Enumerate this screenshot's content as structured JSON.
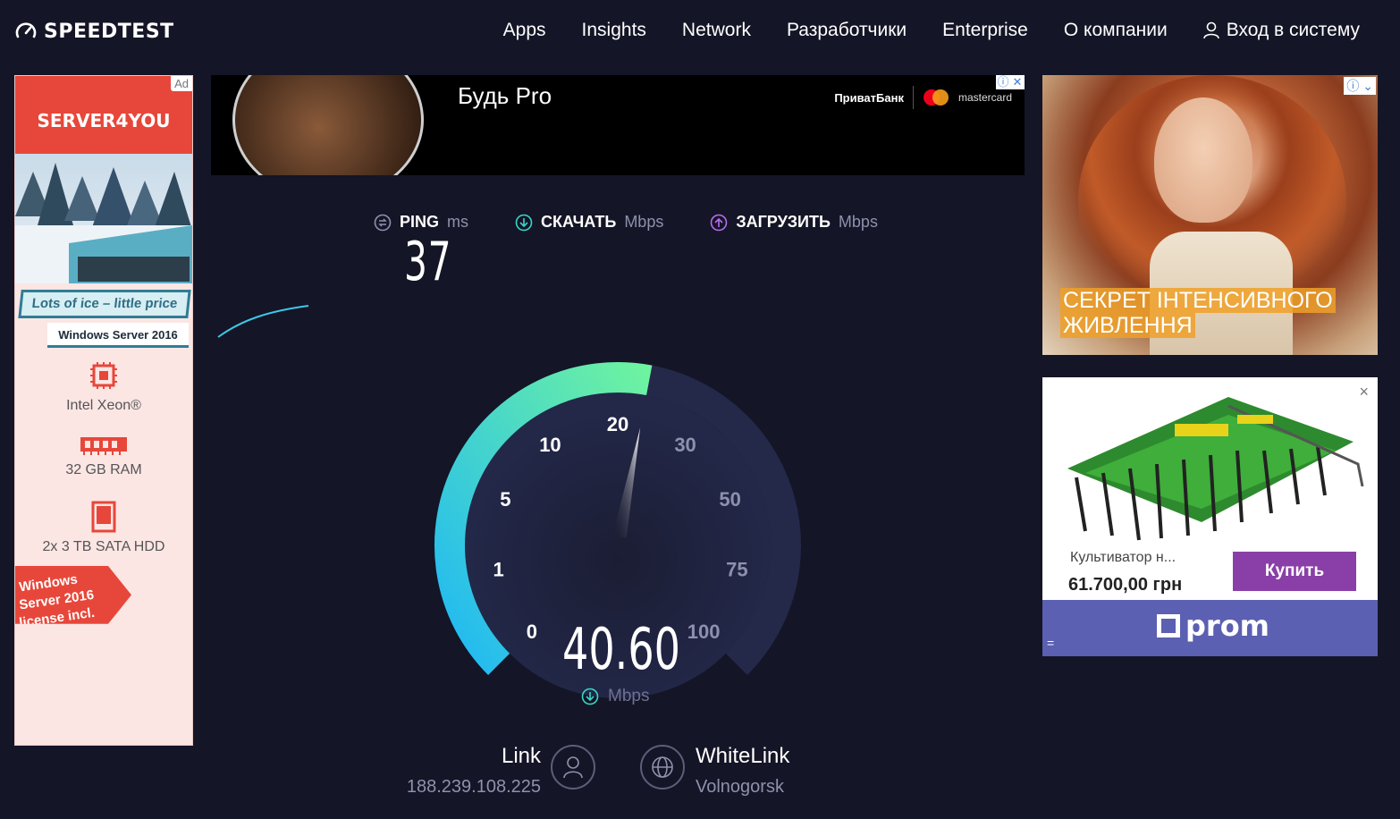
{
  "header": {
    "logo": "SPEEDTEST",
    "nav": [
      "Apps",
      "Insights",
      "Network",
      "Разработчики",
      "Enterprise",
      "О компании"
    ],
    "login": "Вход в систему"
  },
  "ads": {
    "left": {
      "badge": "Ad",
      "brand": "SERVER4YOU",
      "tagline": "Lots of ice – little price",
      "os": "Windows Server 2016",
      "specs": [
        "Intel Xeon®",
        "32 GB RAM",
        "2x 3 TB SATA HDD"
      ],
      "ribbon": [
        "Windows",
        "Server 2016",
        "license incl."
      ]
    },
    "top": {
      "title": "Будь Pro",
      "bank": "ПриватБанк",
      "card": "mastercard"
    },
    "right1": {
      "text_line1": "СЕКРЕТ ІНТЕНСИВНОГО",
      "text_line2": "ЖИВЛЕННЯ"
    },
    "right2": {
      "title": "Культиватор н...",
      "price": "61.700,00 грн",
      "buy": "Купить",
      "logo": "prom",
      "close": "×"
    }
  },
  "speedtest": {
    "ping_label": "PING",
    "ping_unit": "ms",
    "download_label": "СКАЧАТЬ",
    "download_unit": "Mbps",
    "upload_label": "ЗАГРУЗИТЬ",
    "upload_unit": "Mbps",
    "ping_value": "37",
    "speed_value": "40.60",
    "speed_unit": "Mbps",
    "gauge_ticks": [
      "0",
      "1",
      "5",
      "10",
      "20",
      "30",
      "50",
      "75",
      "100"
    ],
    "progress": 0.54,
    "colors": {
      "arc_start": "#1fb8f5",
      "arc_end": "#6ef3a0",
      "track": "#24294a",
      "background": "#141526"
    }
  },
  "connection": {
    "isp_name": "Link",
    "isp_ip": "188.239.108.225",
    "server_name": "WhiteLink",
    "server_location": "Volnogorsk"
  }
}
